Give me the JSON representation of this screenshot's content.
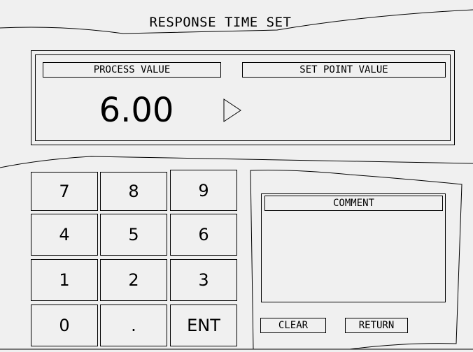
{
  "title": "RESPONSE TIME SET",
  "display": {
    "pv_label": "PROCESS VALUE",
    "sp_label": "SET POINT VALUE",
    "pv_value": "6.00",
    "sp_value": ""
  },
  "keypad": {
    "k7": "7",
    "k8": "8",
    "k9": "9",
    "k4": "4",
    "k5": "5",
    "k6": "6",
    "k1": "1",
    "k2": "2",
    "k3": "3",
    "k0": "0",
    "dot": ".",
    "ent": "ENT"
  },
  "comment": {
    "label": "COMMENT",
    "text": ""
  },
  "buttons": {
    "clear": "CLEAR",
    "return": "RETURN"
  },
  "icons": {
    "setpoint_arrow": "triangle-right-icon"
  }
}
